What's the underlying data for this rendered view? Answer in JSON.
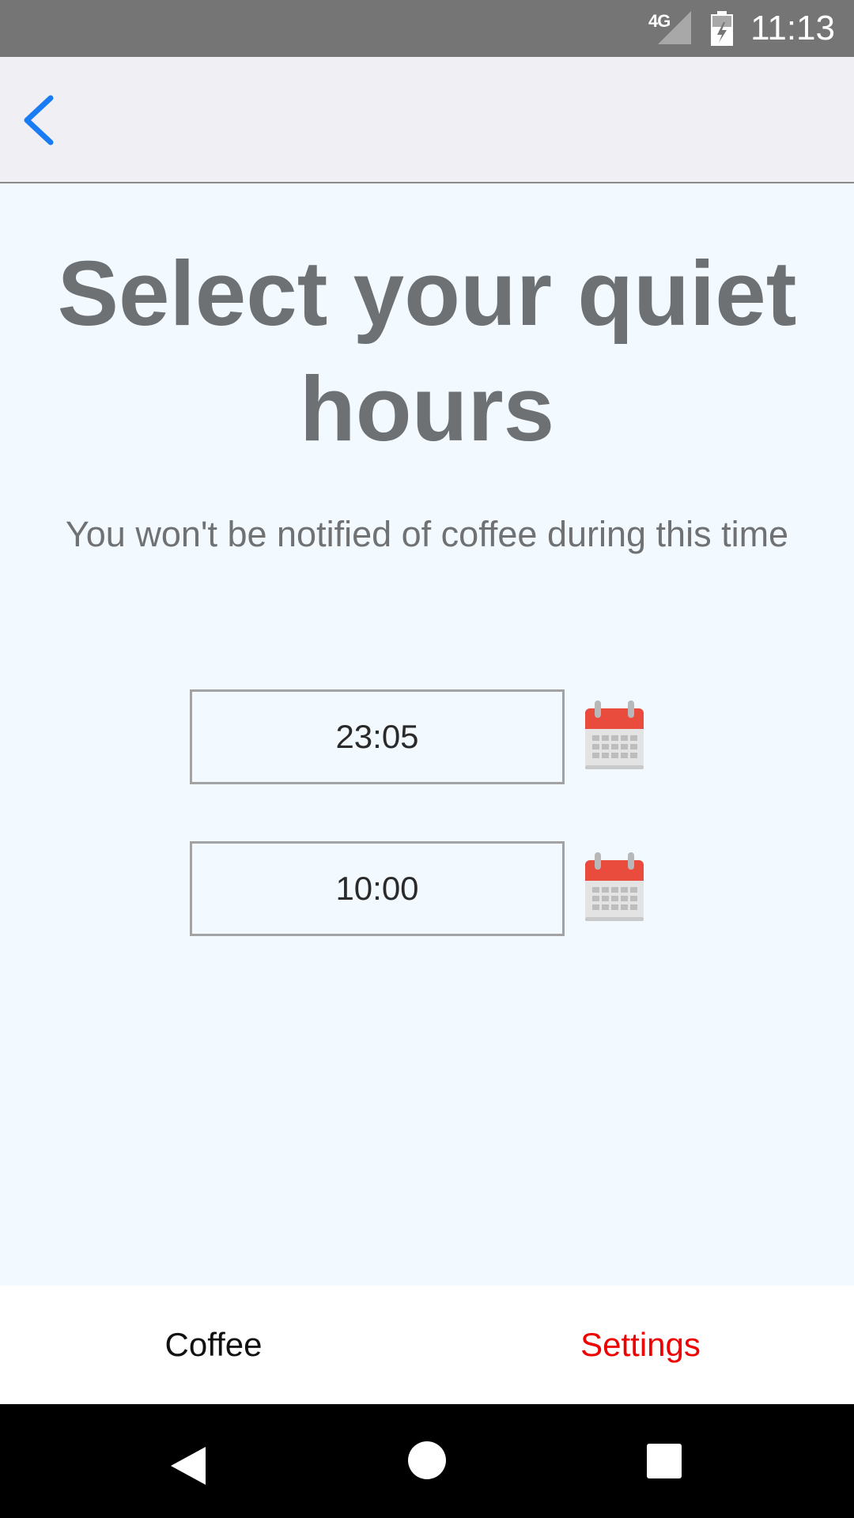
{
  "status_bar": {
    "network": "4G",
    "time": "11:13",
    "icons": [
      "signal-icon",
      "battery-icon"
    ]
  },
  "nav": {
    "back_icon": "chevron-left-icon"
  },
  "main": {
    "title": "Select your quiet hours",
    "subtitle": "You won't be notified of coffee during this time",
    "start_time": "23:05",
    "end_time": "10:00",
    "calendar_icon": "calendar-icon"
  },
  "tabs": [
    {
      "label": "Coffee",
      "active": false
    },
    {
      "label": "Settings",
      "active": true
    }
  ],
  "system_nav": {
    "icons": [
      "back-triangle-icon",
      "home-circle-icon",
      "recents-square-icon"
    ]
  },
  "colors": {
    "accent_blue": "#1a7cf5",
    "active_tab": "#ee0000",
    "inactive_tab": "#111111",
    "title_gray": "#6e7173",
    "calendar_red": "#e94b3c",
    "background": "#f3faff"
  }
}
